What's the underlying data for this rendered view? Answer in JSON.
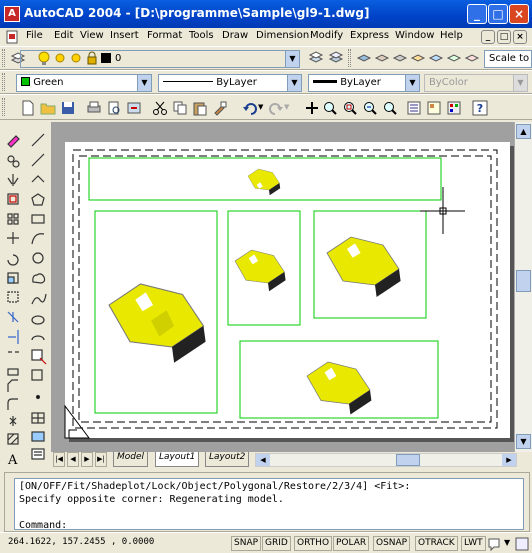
{
  "window": {
    "title": "AutoCAD 2004 - [D:\\programme\\Sample\\gl9-1.dwg]",
    "app_icon_letter": "A"
  },
  "window_controls": {
    "minimize": "_",
    "maximize": "□",
    "close": "×"
  },
  "document_controls": {
    "minimize": "_",
    "maximize": "□",
    "close": "×"
  },
  "menu": [
    "File",
    "Edit",
    "View",
    "Insert",
    "Format",
    "Tools",
    "Draw",
    "Dimension",
    "Modify",
    "Express",
    "Window",
    "Help"
  ],
  "layer": {
    "current": "0",
    "scale_placeholder": "Scale to fit"
  },
  "properties": {
    "color": "Green",
    "linetype": "ByLayer",
    "lineweight": "ByLayer",
    "plotstyle": "ByColor"
  },
  "layout_tabs": [
    "Model",
    "Layout1",
    "Layout2"
  ],
  "active_tab": "Model",
  "command_lines": [
    "[ON/OFF/Fit/Shadeplot/Lock/Object/Polygonal/Restore/2/3/4] <Fit>:",
    "Specify opposite corner: Regenerating model.",
    "",
    "Command:"
  ],
  "status": {
    "coordinates": "264.1622, 157.2455 , 0.0000",
    "toggles": [
      "SNAP",
      "GRID",
      "ORTHO",
      "POLAR",
      "OSNAP",
      "OTRACK",
      "LWT"
    ]
  },
  "colors": {
    "title_bar": "#0a5fe0",
    "viewport_border": "#00cc00",
    "model_fill": "#e8e800",
    "color_swatch": "#00c000"
  }
}
